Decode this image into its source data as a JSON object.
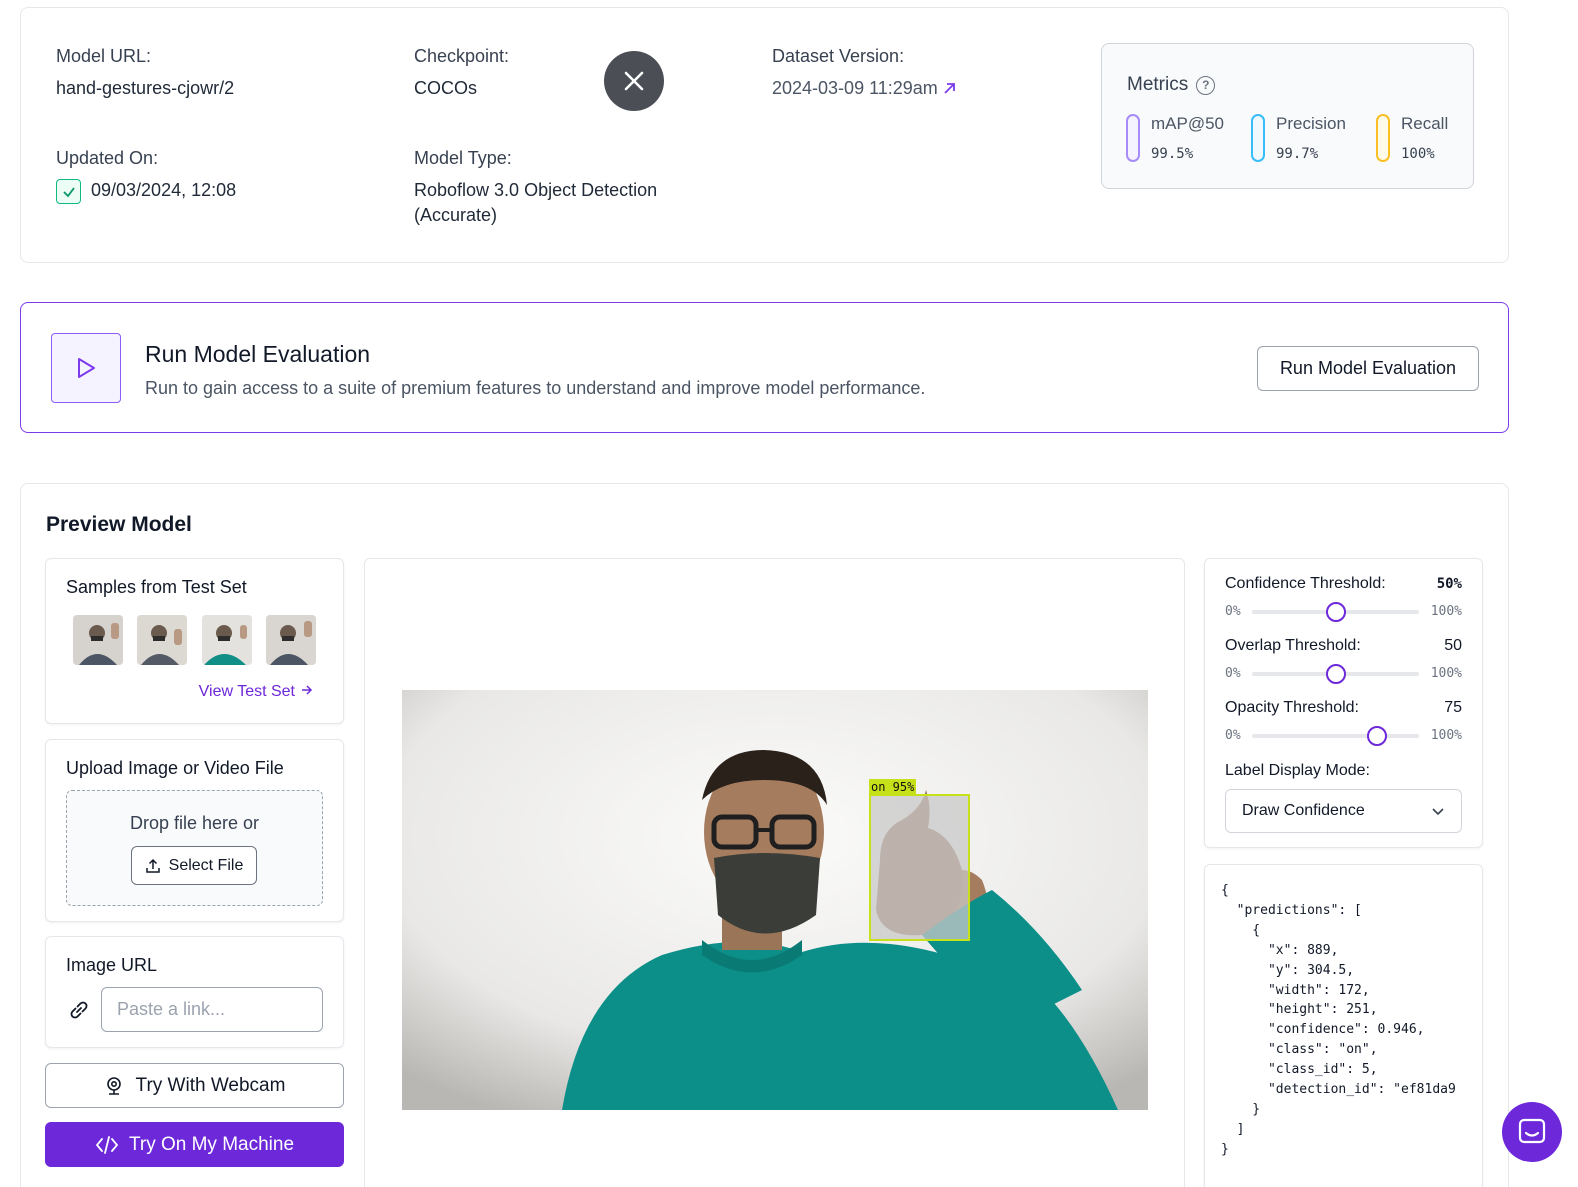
{
  "info": {
    "model_url_label": "Model URL:",
    "model_url_value": "hand-gestures-cjowr/2",
    "checkpoint_label": "Checkpoint:",
    "checkpoint_value": "COCOs",
    "dataset_version_label": "Dataset Version:",
    "dataset_version_value": "2024-03-09 11:29am",
    "updated_on_label": "Updated On:",
    "updated_on_value": "09/03/2024, 12:08",
    "model_type_label": "Model Type:",
    "model_type_line1": "Roboflow 3.0 Object Detection",
    "model_type_line2": "(Accurate)",
    "close_icon": "close-icon",
    "external_link_icon": "arrow-up-right-icon"
  },
  "metrics": {
    "title": "Metrics",
    "items": [
      {
        "label": "mAP@50",
        "value": "99.5%",
        "color": "#a78bfa"
      },
      {
        "label": "Precision",
        "value": "99.7%",
        "color": "#38bdf8"
      },
      {
        "label": "Recall",
        "value": "100%",
        "color": "#fbbf24"
      }
    ]
  },
  "evaluation": {
    "title": "Run Model Evaluation",
    "description": "Run to gain access to a suite of premium features to understand and improve model performance.",
    "button_label": "Run Model Evaluation",
    "accent": "#7c3aed"
  },
  "preview": {
    "title": "Preview Model",
    "samples_title": "Samples from Test Set",
    "view_test_set": "View Test Set",
    "upload_title": "Upload Image or Video File",
    "drop_text": "Drop file here or",
    "select_file": "Select File",
    "image_url_title": "Image URL",
    "url_placeholder": "Paste a link...",
    "webcam_button": "Try With Webcam",
    "machine_button": "Try On My Machine",
    "detection_label": "on 95%"
  },
  "controls": {
    "confidence_label": "Confidence Threshold:",
    "confidence_value": "50%",
    "confidence_level": 0.5,
    "overlap_label": "Overlap Threshold:",
    "overlap_value": "50",
    "overlap_level": 0.5,
    "opacity_label": "Opacity Threshold:",
    "opacity_value": "75",
    "opacity_level": 0.75,
    "min": "0%",
    "max": "100%",
    "label_mode_label": "Label Display Mode:",
    "label_mode_value": "Draw Confidence"
  },
  "json_output": "{\n  \"predictions\": [\n    {\n      \"x\": 889,\n      \"y\": 304.5,\n      \"width\": 172,\n      \"height\": 251,\n      \"confidence\": 0.946,\n      \"class\": \"on\",\n      \"class_id\": 5,\n      \"detection_id\": \"ef81da9\n    }\n  ]\n}"
}
